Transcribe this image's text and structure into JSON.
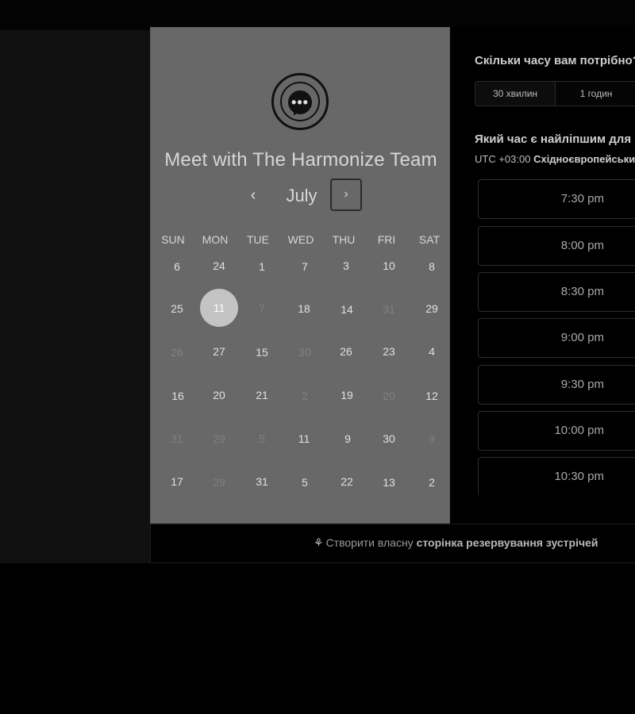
{
  "header": {
    "logo_icon": "chat-bubble-icon",
    "title": "Meet with The Harmonize Team"
  },
  "calendar": {
    "month": "July",
    "prev_icon": "chevron-left-icon",
    "next_icon": "chevron-right-icon",
    "prev_glyph": "‹",
    "next_glyph": "›",
    "weekdays": [
      "SUN",
      "MON",
      "TUE",
      "WED",
      "THU",
      "FRI",
      "SAT"
    ],
    "weeks": [
      [
        "6",
        "24",
        "1",
        "7",
        "3",
        "10",
        "8"
      ],
      [
        "25",
        "11",
        "7",
        "18",
        "14",
        "31",
        "29"
      ],
      [
        "26",
        "27",
        "15",
        "30",
        "26",
        "23",
        "4"
      ],
      [
        "16",
        "20",
        "21",
        "2",
        "19",
        "20",
        "12"
      ],
      [
        "31",
        "29",
        "5",
        "11",
        "9",
        "30",
        "9"
      ],
      [
        "17",
        "29",
        "31",
        "5",
        "22",
        "13",
        "2"
      ]
    ],
    "selected_day": "11"
  },
  "duration": {
    "question": "Скільки часу вам потрібно?",
    "options": [
      "30 хвилин",
      "1 годин"
    ]
  },
  "time": {
    "question": "Який час є найліпшим для вас?",
    "timezone_offset": "UTC +03:00",
    "timezone_name": "Східноєвропейський час",
    "slots": [
      "7:30 pm",
      "8:00 pm",
      "8:30 pm",
      "9:00 pm",
      "9:30 pm",
      "10:00 pm",
      "10:30 pm"
    ]
  },
  "footer": {
    "icon": "sprout-icon",
    "icon_glyph": "⚘",
    "text_prefix": "Створити власну",
    "text_bold": "сторінка резервування зустрічей"
  },
  "colors": {
    "left_panel_bg": "#686868",
    "selected_day_bg": "#c4c4c4",
    "right_panel_bg": "#000000"
  }
}
